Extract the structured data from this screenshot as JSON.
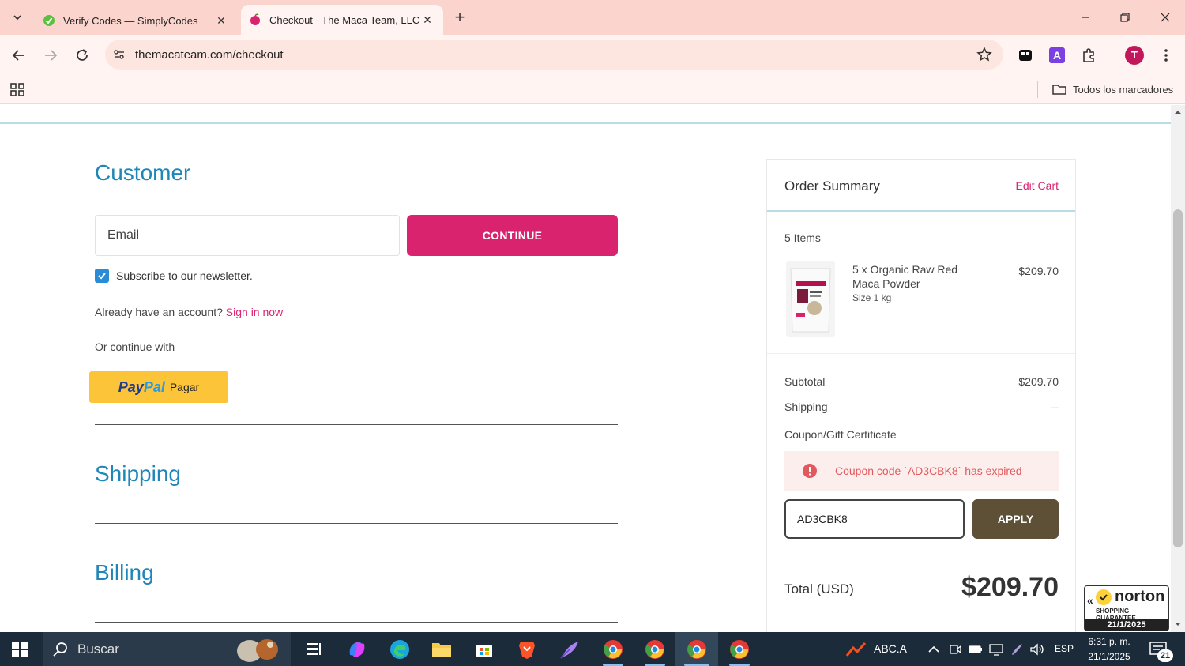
{
  "browser": {
    "tabs": [
      {
        "title": "Verify Codes — SimplyCodes",
        "icon": "simplycodes-icon"
      },
      {
        "title": "Checkout - The Maca Team, LLC",
        "icon": "maca-icon"
      }
    ],
    "url": "themacateam.com/checkout",
    "bookmarks_all": "Todos los marcadores",
    "profile_initial": "T"
  },
  "customer": {
    "title": "Customer",
    "email_placeholder": "Email",
    "continue_label": "CONTINUE",
    "newsletter_label": "Subscribe to our newsletter.",
    "newsletter_checked": true,
    "account_text": "Already have an account?",
    "signin_label": "Sign in now",
    "or_continue": "Or continue with",
    "paypal_logo_a": "Pay",
    "paypal_logo_b": "Pal",
    "paypal_label": "Pagar"
  },
  "shipping": {
    "title": "Shipping"
  },
  "billing": {
    "title": "Billing"
  },
  "summary": {
    "title": "Order Summary",
    "edit_cart": "Edit Cart",
    "items_count": "5 Items",
    "item": {
      "name": "5 x Organic Raw Red Maca Powder",
      "size": "Size 1 kg",
      "price": "$209.70"
    },
    "subtotal_label": "Subtotal",
    "subtotal_value": "$209.70",
    "shipping_label": "Shipping",
    "shipping_value": "--",
    "coupon_label": "Coupon/Gift Certificate",
    "coupon_error": "Coupon code `AD3CBK8` has expired",
    "coupon_value": "AD3CBK8",
    "apply_label": "APPLY",
    "total_label": "Total (USD)",
    "total_value": "$209.70"
  },
  "norton": {
    "name": "norton",
    "guarantee": "SHOPPING GUARANTEE",
    "date": "21/1/2025"
  },
  "taskbar": {
    "search_text": "Buscar",
    "stock_label": "ABC.A",
    "language": "ESP",
    "time": "6:31 p. m.",
    "date": "21/1/2025",
    "notifications": "21"
  },
  "colors": {
    "accent": "#d9236f",
    "heading": "#1f86b8",
    "apply": "#5e5036",
    "paypal": "#fcc439"
  }
}
